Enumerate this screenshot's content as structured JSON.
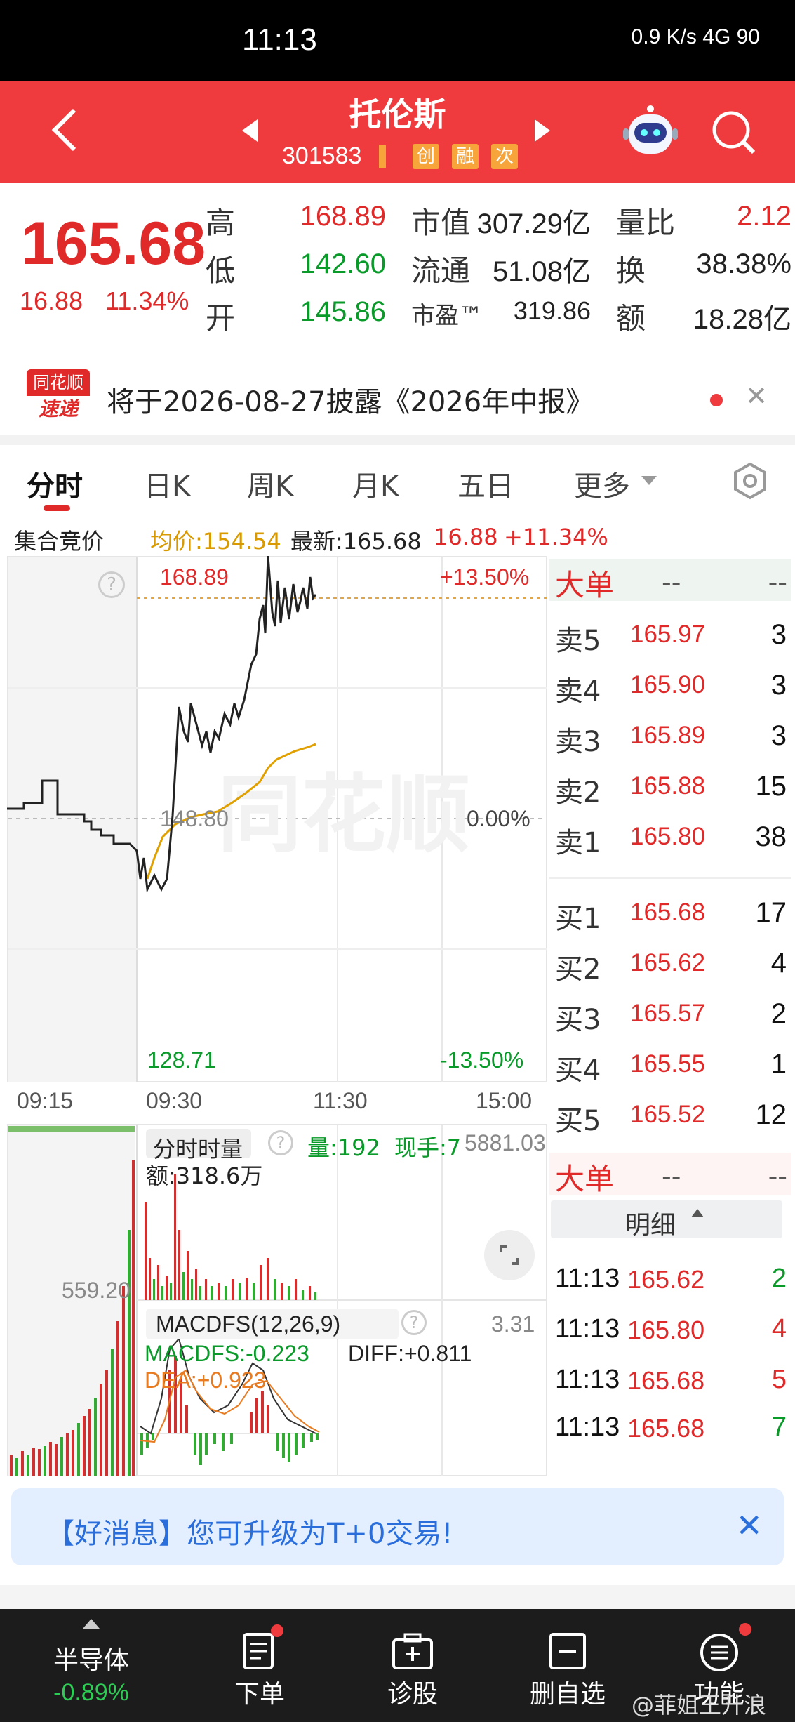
{
  "status_bar": {
    "time": "11:13",
    "icons_text": "0.9 K/s  4G  90"
  },
  "header": {
    "title": "托伦斯",
    "code": "301583",
    "tags": [
      "创",
      "融",
      "次"
    ]
  },
  "quote": {
    "price": "165.68",
    "change": "16.88",
    "change_pct": "11.34%",
    "high_label": "高",
    "high": "168.89",
    "low_label": "低",
    "low": "142.60",
    "open_label": "开",
    "open": "145.86",
    "mcap_label": "市值",
    "mcap": "307.29亿",
    "float_label": "流通",
    "float": "51.08亿",
    "pe_label": "市盈™",
    "pe": "319.86",
    "volratio_label": "量比",
    "volratio": "2.12",
    "turnover_label": "换",
    "turnover": "38.38%",
    "amount_label": "额",
    "amount": "18.28亿"
  },
  "notice": {
    "logo_top": "同花顺",
    "logo_bottom": "速递",
    "text": "将于2026-08-27披露《2026年中报》"
  },
  "tabs": [
    "分时",
    "日K",
    "周K",
    "月K",
    "五日",
    "更多"
  ],
  "auction": {
    "label": "集合竞价",
    "avg": "均价:154.54",
    "latest": "最新:165.68",
    "chg": "16.88",
    "pct": "+11.34%"
  },
  "chart": {
    "high_price": "168.89",
    "high_pct": "+13.50%",
    "mid_price": "148.80",
    "mid_pct": "0.00%",
    "low_price": "128.71",
    "low_pct": "-13.50%",
    "times": [
      "09:15",
      "09:30",
      "11:30",
      "15:00"
    ],
    "watermark": "同花顺",
    "vol_title": "分时时量",
    "vol_value": "量:192",
    "vol_hand": "现手:7",
    "vol_amount": "额:318.6万",
    "vol_max": "5881.03",
    "auction_max": "559.20",
    "macd_title": "MACDFS(12,26,9)",
    "macd_value": "MACDFS:-0.223",
    "diff_value": "DIFF:+0.811",
    "dea_value": "DEA:+0.923",
    "macd_max": "3.31"
  },
  "order_book": {
    "big_label": "大单",
    "dash": "--",
    "asks": [
      {
        "label": "卖5",
        "price": "165.97",
        "vol": "3"
      },
      {
        "label": "卖4",
        "price": "165.90",
        "vol": "3"
      },
      {
        "label": "卖3",
        "price": "165.89",
        "vol": "3"
      },
      {
        "label": "卖2",
        "price": "165.88",
        "vol": "15"
      },
      {
        "label": "卖1",
        "price": "165.80",
        "vol": "38"
      }
    ],
    "bids": [
      {
        "label": "买1",
        "price": "165.68",
        "vol": "17"
      },
      {
        "label": "买2",
        "price": "165.62",
        "vol": "4"
      },
      {
        "label": "买3",
        "price": "165.57",
        "vol": "2"
      },
      {
        "label": "买4",
        "price": "165.55",
        "vol": "1"
      },
      {
        "label": "买5",
        "price": "165.52",
        "vol": "12"
      }
    ],
    "detail_label": "明细",
    "ticks": [
      {
        "time": "11:13",
        "price": "165.62",
        "vol": "2",
        "side": "buy"
      },
      {
        "time": "11:13",
        "price": "165.80",
        "vol": "4",
        "side": "sell"
      },
      {
        "time": "11:13",
        "price": "165.68",
        "vol": "5",
        "side": "sell"
      },
      {
        "time": "11:13",
        "price": "165.68",
        "vol": "7",
        "side": "buy"
      }
    ]
  },
  "banner": {
    "text": "【好消息】您可升级为T+0交易!"
  },
  "bottom_nav": {
    "sector": "半导体",
    "sector_pct": "-0.89%",
    "items": [
      "下单",
      "诊股",
      "删自选",
      "功能"
    ],
    "watermark": "@菲姐王升浪"
  }
}
